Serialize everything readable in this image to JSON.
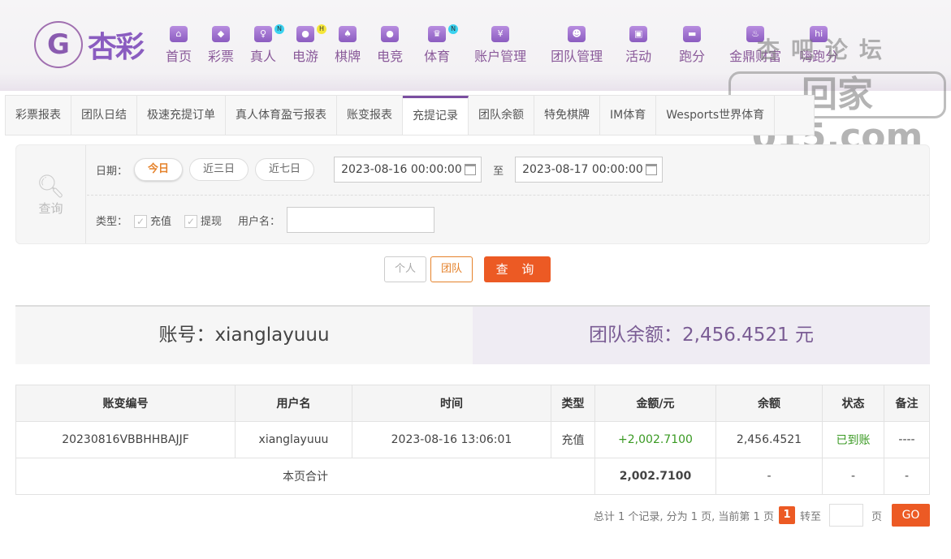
{
  "header": {
    "logo_text": "杏彩",
    "nav": [
      {
        "label": "首页",
        "icon": "home-icon"
      },
      {
        "label": "彩票",
        "icon": "ticket-icon"
      },
      {
        "label": "真人",
        "icon": "dealer-icon",
        "badge": "N",
        "badge_color": "#3ad2f0"
      },
      {
        "label": "电游",
        "icon": "gamepad-icon",
        "badge": "H",
        "badge_color": "#f5e63a"
      },
      {
        "label": "棋牌",
        "icon": "cards-icon"
      },
      {
        "label": "电竞",
        "icon": "gamepad-icon"
      },
      {
        "label": "体育",
        "icon": "trophy-icon",
        "badge": "N",
        "badge_color": "#3ad2f0"
      },
      {
        "label": "账户管理",
        "icon": "yen-icon"
      },
      {
        "label": "团队管理",
        "icon": "team-icon"
      },
      {
        "label": "活动",
        "icon": "gift-icon"
      },
      {
        "label": "跑分",
        "icon": "rhino-icon"
      },
      {
        "label": "金鼎财富",
        "icon": "cauldron-icon"
      },
      {
        "label": "嗨跑分",
        "icon": "hi-icon"
      }
    ]
  },
  "watermark": {
    "top": "杏吧论坛",
    "bottom": "回家015.com"
  },
  "tabs": [
    "彩票报表",
    "团队日结",
    "极速充提订单",
    "真人体育盈亏报表",
    "账变报表",
    "充提记录",
    "团队余额",
    "特免棋牌",
    "IM体育",
    "Wesports世界体育"
  ],
  "active_tab": 5,
  "filter": {
    "search_label": "查询",
    "date_label": "日期：",
    "date_options": [
      "今日",
      "近三日",
      "近七日"
    ],
    "start": "2023-08-16 00:00:00",
    "to": "至",
    "end": "2023-08-17 00:00:00",
    "type_label": "类型：",
    "types": [
      "充值",
      "提现"
    ],
    "username_label": "用户名：",
    "username_value": ""
  },
  "actions": {
    "personal": "个人",
    "team": "团队",
    "query": "查 询"
  },
  "summary": {
    "account": "账号：xianglayuuu",
    "balance": "团队余额：2,456.4521 元"
  },
  "table": {
    "headers": [
      "账变编号",
      "用户名",
      "时间",
      "类型",
      "金额/元",
      "余额",
      "状态",
      "备注"
    ],
    "rows": [
      [
        "20230816VBBHHBAJJF",
        "xianglayuuu",
        "2023-08-16 13:06:01",
        "充值",
        "+2,002.7100",
        "2,456.4521",
        "已到账",
        "----"
      ]
    ],
    "total": {
      "label": "本页合计",
      "amount": "2,002.7100",
      "balance": "-",
      "status": "-",
      "note": "-"
    }
  },
  "pager": {
    "text": "总计 1 个记录, 分为 1 页, 当前第 1 页",
    "current": "1",
    "goto": "转至",
    "page_unit": "页",
    "go": "GO"
  },
  "colors": {
    "accent": "#ec5a24",
    "brand": "#8a5cc0"
  }
}
